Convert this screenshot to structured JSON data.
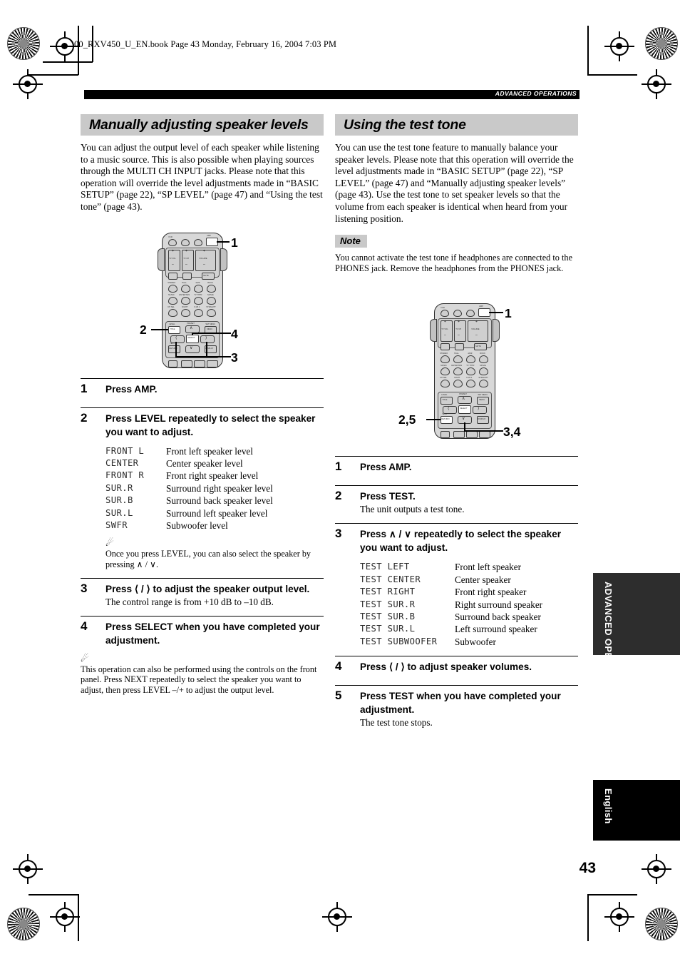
{
  "file_header": "00_RXV450_U_EN.book  Page 43  Monday, February 16, 2004  7:03 PM",
  "runner": "ADVANCED OPERATIONS",
  "page_number": "43",
  "side_tabs": {
    "section": "ADVANCED OPERATION",
    "language": "English"
  },
  "left_column": {
    "title": "Manually adjusting speaker levels",
    "intro": "You can adjust the output level of each speaker while listening to a music source. This is also possible when playing sources through the MULTI CH INPUT jacks. Please note that this operation will override the level adjustments made in “BASIC SETUP” (page 22), “SP LEVEL” (page 47) and “Using the test tone” (page 43).",
    "figure": {
      "alt": "Remote control with callouts",
      "callouts": [
        "1",
        "2",
        "4",
        "3"
      ]
    },
    "steps": [
      {
        "num": "1",
        "head": "Press AMP.",
        "sub": ""
      },
      {
        "num": "2",
        "head": "Press LEVEL repeatedly to select the speaker you want to adjust.",
        "sub": ""
      },
      {
        "num": "3",
        "head": "Press ⟨ / ⟩ to adjust the speaker output level.",
        "sub": "The control range is from +10 dB to –10 dB."
      },
      {
        "num": "4",
        "head": "Press SELECT when you have completed your adjustment.",
        "sub": ""
      }
    ],
    "level_table": [
      {
        "code": "FRONT L",
        "desc": "Front left speaker level"
      },
      {
        "code": "CENTER",
        "desc": "Center speaker level"
      },
      {
        "code": "FRONT R",
        "desc": "Front right speaker level"
      },
      {
        "code": "SUR.R",
        "desc": "Surround right speaker level"
      },
      {
        "code": "SUR.B",
        "desc": "Surround back speaker level"
      },
      {
        "code": "SUR.L",
        "desc": "Surround left speaker level"
      },
      {
        "code": "SWFR",
        "desc": "Subwoofer level"
      }
    ],
    "tip_after_step2": "Once you press LEVEL, you can also select the speaker by pressing ∧ / ∨.",
    "tip_final": "This operation can also be performed using the controls on the front panel. Press NEXT repeatedly to select the speaker you want to adjust, then press LEVEL –/+ to adjust the output level."
  },
  "right_column": {
    "title": "Using the test tone",
    "intro": "You can use the test tone feature to manually balance your speaker levels. Please note that this operation will override the level adjustments made in “BASIC SETUP” (page 22), “SP LEVEL” (page 47) and “Manually adjusting speaker levels” (page 43). Use the test tone to set speaker levels so that the volume from each speaker is identical when heard from your listening position.",
    "note_label": "Note",
    "note_text": "You cannot activate the test tone if headphones are connected to the PHONES jack. Remove the headphones from the PHONES jack.",
    "figure": {
      "alt": "Remote control with callouts",
      "callouts": [
        "1",
        "2,5",
        "3,4"
      ]
    },
    "steps": [
      {
        "num": "1",
        "head": "Press AMP.",
        "sub": ""
      },
      {
        "num": "2",
        "head": "Press TEST.",
        "sub": "The unit outputs a test tone."
      },
      {
        "num": "3",
        "head": "Press ∧ / ∨ repeatedly to select the speaker you want to adjust.",
        "sub": ""
      },
      {
        "num": "4",
        "head": "Press ⟨ / ⟩ to adjust speaker volumes.",
        "sub": ""
      },
      {
        "num": "5",
        "head": "Press TEST when you have completed your adjustment.",
        "sub": "The test tone stops."
      }
    ],
    "test_table": [
      {
        "code": "TEST LEFT",
        "desc": "Front left speaker"
      },
      {
        "code": "TEST CENTER",
        "desc": "Center speaker"
      },
      {
        "code": "TEST RIGHT",
        "desc": "Front right speaker"
      },
      {
        "code": "TEST SUR.R",
        "desc": "Right surround speaker"
      },
      {
        "code": "TEST SUR.B",
        "desc": "Surround back speaker"
      },
      {
        "code": "TEST SUR.L",
        "desc": "Left surround speaker"
      },
      {
        "code": "TEST SUBWOOFER",
        "desc": "Subwoofer"
      }
    ]
  },
  "remote_labels": {
    "top_row": [
      "VCR",
      "✶",
      "✷",
      "AMP"
    ],
    "rockers": [
      "TV VOL",
      "TV CH",
      "VOLUME"
    ],
    "small_buttons": [
      "TV MUTE",
      "TV INPUT",
      "MUTE"
    ],
    "dsp_row1": [
      "STEREO",
      "HALL",
      "JAZZ",
      "ROCK"
    ],
    "dsp_row2": [
      "MUSIC",
      "ENTERTAIN",
      "TV THTR",
      "MOVIE"
    ],
    "dsp_row3": [
      "CH SEL",
      "NIGHT",
      "6.1/5.1",
      "STRAIGHT"
    ],
    "pad_labels": [
      "LEVEL",
      "TITLE",
      "PRESET",
      "SET MENU",
      "MENU",
      "SELECT",
      "TEST",
      "RETURN",
      "DISPLAY"
    ],
    "center_key": "SELECT",
    "bottom_row": [
      "POWER",
      "SRCH",
      "INDEX",
      "AUDIO"
    ]
  },
  "tip_icon": "☀"
}
